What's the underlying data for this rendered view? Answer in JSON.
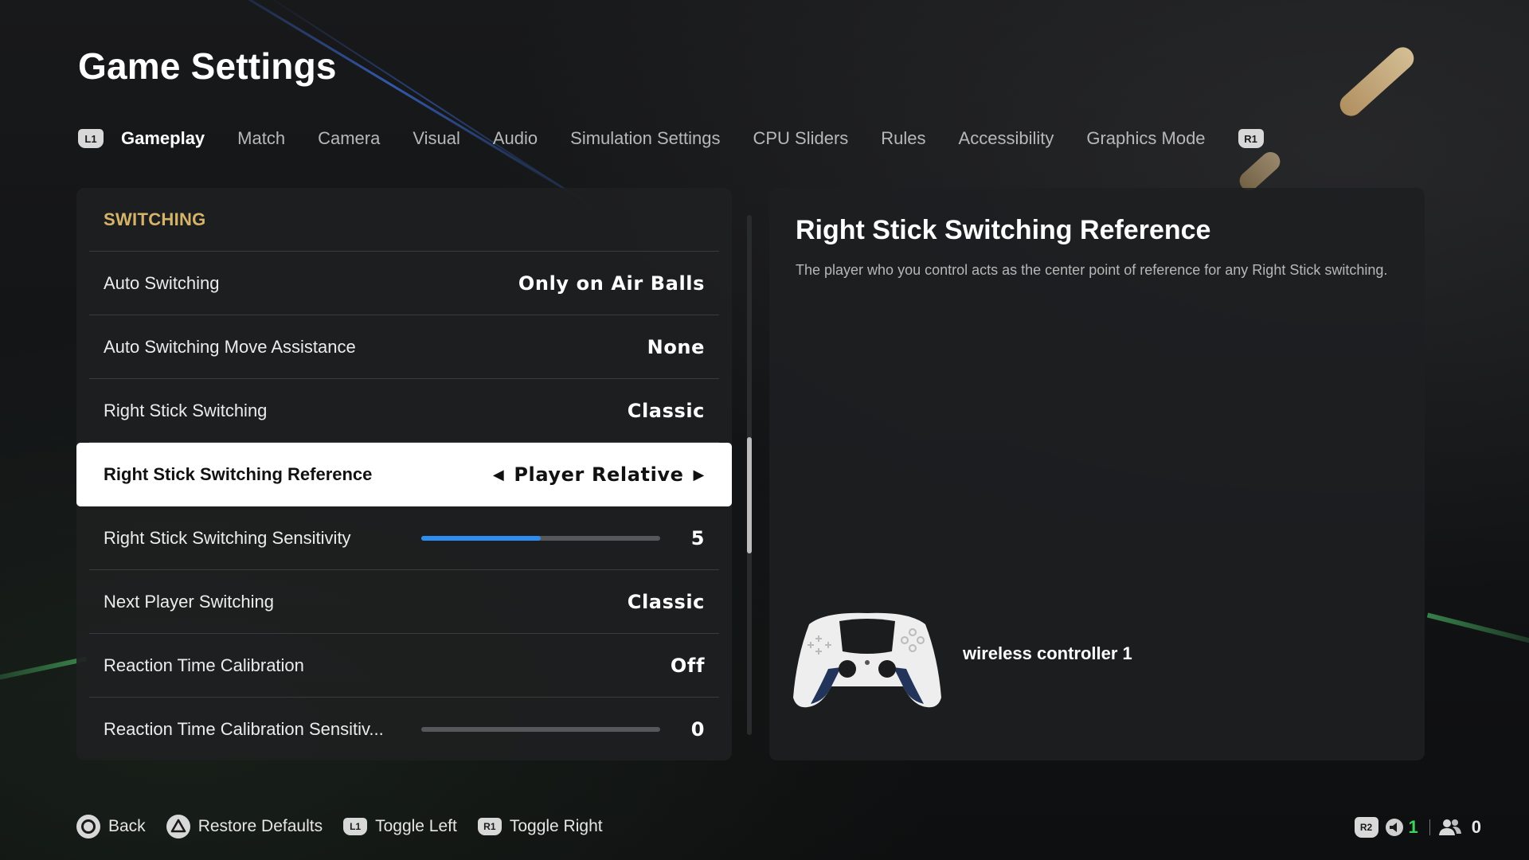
{
  "page": {
    "title": "Game Settings"
  },
  "tabs": {
    "left_bumper": "L1",
    "right_bumper": "R1",
    "items": [
      {
        "label": "Gameplay",
        "active": true
      },
      {
        "label": "Match"
      },
      {
        "label": "Camera"
      },
      {
        "label": "Visual"
      },
      {
        "label": "Audio"
      },
      {
        "label": "Simulation Settings"
      },
      {
        "label": "CPU Sliders"
      },
      {
        "label": "Rules"
      },
      {
        "label": "Accessibility"
      },
      {
        "label": "Graphics Mode"
      }
    ]
  },
  "settings": {
    "section": "SWITCHING",
    "rows": [
      {
        "label": "Auto Switching",
        "value": "Only on Air Balls"
      },
      {
        "label": "Auto Switching Move Assistance",
        "value": "None"
      },
      {
        "label": "Right Stick Switching",
        "value": "Classic"
      },
      {
        "label": "Right Stick Switching Reference",
        "value": "Player Relative",
        "selected": true
      },
      {
        "label": "Right Stick Switching Sensitivity",
        "value": "5",
        "slider_fraction": 0.5
      },
      {
        "label": "Next Player Switching",
        "value": "Classic"
      },
      {
        "label": "Reaction Time Calibration",
        "value": "Off"
      },
      {
        "label": "Reaction Time Calibration Sensitiv...",
        "value": "0",
        "slider_fraction": 0.0
      }
    ],
    "scroll_fraction": 0.55
  },
  "description": {
    "title": "Right Stick Switching Reference",
    "text": "The player who you control acts as the center point of reference for any Right Stick switching.",
    "controller_label": "wireless controller 1"
  },
  "footer": {
    "back": "Back",
    "restore": "Restore Defaults",
    "toggle_left_badge": "L1",
    "toggle_left": "Toggle Left",
    "toggle_right_badge": "R1",
    "toggle_right": "Toggle Right"
  },
  "status": {
    "r2_badge": "R2",
    "voice_count": "1",
    "users_count": "0"
  },
  "colors": {
    "accent_blue": "#2f8cf0",
    "section_gold": "#d5b46a",
    "status_green": "#3fd15b"
  }
}
